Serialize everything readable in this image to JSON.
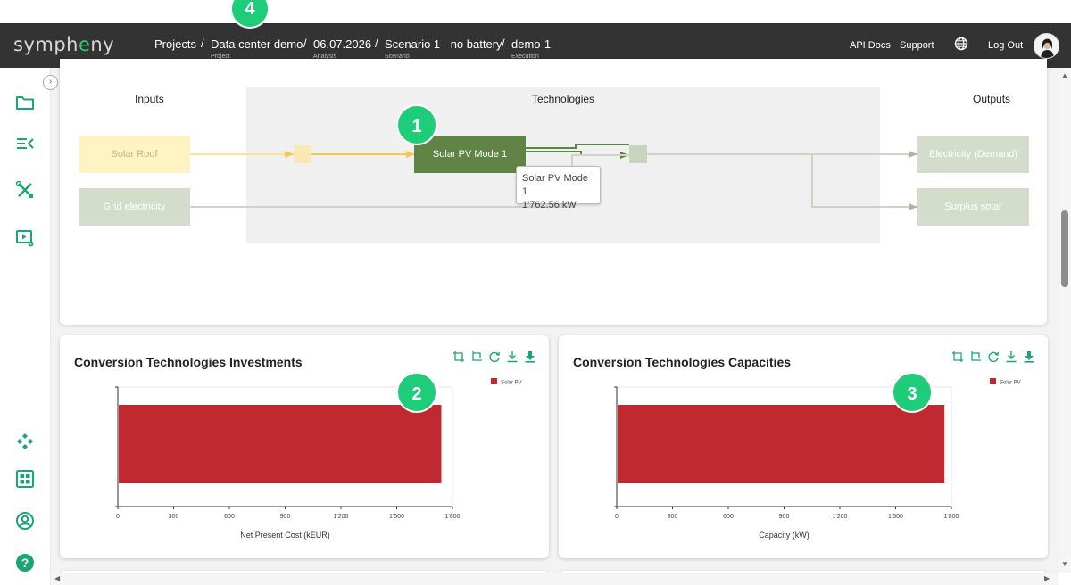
{
  "app": {
    "logo_text": "sympheny"
  },
  "breadcrumbs": [
    {
      "label": "Projects",
      "sub": ""
    },
    {
      "label": "Data center demo",
      "sub": "Project"
    },
    {
      "label": "06.07.2026",
      "sub": "Analysis"
    },
    {
      "label": "Scenario 1 - no battery",
      "sub": "Scenario"
    },
    {
      "label": "demo-1",
      "sub": "Execution"
    }
  ],
  "breadcrumb_separator": "/",
  "header_links": {
    "api_docs": "API Docs",
    "support": "Support",
    "logout": "Log Out"
  },
  "badges": {
    "b1": "1",
    "b2": "2",
    "b3": "3",
    "b4": "4"
  },
  "diagram": {
    "inputs_heading": "Inputs",
    "technologies_heading": "Technologies",
    "outputs_heading": "Outputs",
    "inputs": [
      "Solar Roof",
      "Grid electricity"
    ],
    "technology": "Solar PV Mode 1",
    "outputs": [
      "Electricity (Demand)",
      "Surplus solar"
    ],
    "tooltip": {
      "name": "Solar PV Mode 1",
      "value": "1'762.56 kW"
    },
    "colors": {
      "solar": "#fff3c4",
      "solar_line": "#f7d774",
      "tech": "#5f8446",
      "grid": "#d4ddcb",
      "tech_region": "#f0f0f0"
    }
  },
  "charts_ui": {
    "investments_title": "Conversion Technologies Investments",
    "capacities_title": "Conversion Technologies Capacities"
  },
  "chart_data": [
    {
      "type": "bar",
      "orientation": "horizontal",
      "title": "Conversion Technologies Investments",
      "xlabel": "Net Present Cost (kEUR)",
      "ylabel": "",
      "series": [
        {
          "name": "Solar PV",
          "values": [
            1740
          ]
        }
      ],
      "categories": [
        ""
      ],
      "xticks": [
        "0",
        "300",
        "600",
        "900",
        "1'200",
        "1'500",
        "1'800"
      ],
      "xlim": [
        0,
        1800
      ],
      "color": "#c0292f",
      "legend": "top-right"
    },
    {
      "type": "bar",
      "orientation": "horizontal",
      "title": "Conversion Technologies Capacities",
      "xlabel": "Capacity (kW)",
      "ylabel": "",
      "series": [
        {
          "name": "Solar PV",
          "values": [
            1762.56
          ]
        }
      ],
      "categories": [
        ""
      ],
      "xticks": [
        "0",
        "300",
        "600",
        "900",
        "1'200",
        "1'500",
        "1'800"
      ],
      "xlim": [
        0,
        1800
      ],
      "color": "#c0292f",
      "legend": "top-right"
    }
  ]
}
